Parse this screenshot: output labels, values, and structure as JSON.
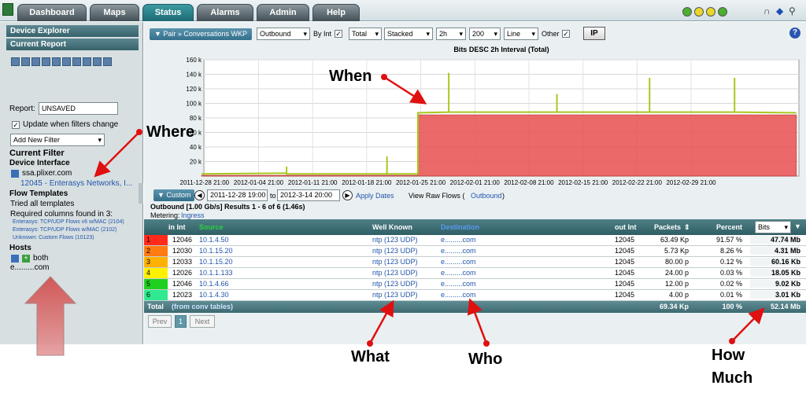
{
  "tabs": [
    {
      "label": "Dashboard",
      "active": false
    },
    {
      "label": "Maps",
      "active": false
    },
    {
      "label": "Status",
      "active": true
    },
    {
      "label": "Alarms",
      "active": false
    },
    {
      "label": "Admin",
      "active": false
    },
    {
      "label": "Help",
      "active": false
    }
  ],
  "status_colors": [
    "#4caf30",
    "#e8d62a",
    "#e8d62a",
    "#4caf30"
  ],
  "sidebar": {
    "device_explorer": "Device Explorer",
    "current_report": "Current Report",
    "report_label": "Report:",
    "report_value": "UNSAVED",
    "update_label": "Update when filters change",
    "add_filter": "Add New Filter",
    "current_filter": "Current Filter",
    "device_interface": "Device Interface",
    "device_host": "ssa.plixer.com",
    "device_iface": "12045 - Enterasys Networks, I...",
    "flow_templates": "Flow Templates",
    "tried": "Tried all templates",
    "required": "Required columns found in 3:",
    "templates": [
      "Enterasys: TCP/UDP Flows v6 w/MAC (2104)",
      "Enterasys: TCP/UDP Flows w/MAC (2102)",
      "Unknown: Custom Flows (10123)"
    ],
    "hosts": "Hosts",
    "both": "both",
    "host_value": "e.........com"
  },
  "toolbar": {
    "crumb": "▼ Pair » Conversations WKP",
    "direction": "Outbound",
    "by_int": "By Int",
    "total": "Total",
    "stacked": "Stacked",
    "interval": "2h",
    "count": "200",
    "line": "Line",
    "other": "Other",
    "ip": "IP",
    "help": "?"
  },
  "chart_data": {
    "type": "area",
    "title": "Bits DESC 2h Interval (Total)",
    "xlabel": "",
    "ylabel": "",
    "ylim": [
      0,
      160
    ],
    "y_ticks": [
      "20 k",
      "40 k",
      "60 k",
      "80 k",
      "100 k",
      "120 k",
      "140 k",
      "160 k"
    ],
    "x_ticks": [
      "2011-12-28 21:00",
      "2012-01-04 21:00",
      "2012-01-11 21:00",
      "2012-01-18 21:00",
      "2012-01-25 21:00",
      "2012-02-01 21:00",
      "2012-02-08 21:00",
      "2012-02-15 21:00",
      "2012-02-22 21:00",
      "2012-02-29 21:00"
    ],
    "x_range": [
      "2011-12-28 19:00",
      "2012-03-14 20:00"
    ],
    "grid": true,
    "series": [
      {
        "color": "#e85050",
        "points": [
          [
            "2011-12-28",
            1
          ],
          [
            "2012-01-25",
            1
          ],
          [
            "2012-01-25",
            84
          ],
          [
            "2012-03-14",
            84
          ]
        ]
      },
      {
        "color": "#a8c820",
        "points": [
          [
            "2011-12-28",
            3
          ],
          [
            "2012-01-08",
            4
          ],
          [
            "2012-01-08",
            13
          ],
          [
            "2012-01-08",
            3
          ],
          [
            "2012-01-21",
            3
          ],
          [
            "2012-01-21",
            27
          ],
          [
            "2012-01-21",
            3
          ],
          [
            "2012-01-25",
            3
          ],
          [
            "2012-01-25",
            87
          ],
          [
            "2012-01-29",
            88
          ],
          [
            "2012-01-29",
            142
          ],
          [
            "2012-01-29",
            88
          ],
          [
            "2012-02-12",
            88
          ],
          [
            "2012-02-12",
            113
          ],
          [
            "2012-02-12",
            88
          ],
          [
            "2012-02-24",
            88
          ],
          [
            "2012-02-24",
            135
          ],
          [
            "2012-02-24",
            88
          ],
          [
            "2012-03-06",
            88
          ],
          [
            "2012-03-06",
            135
          ],
          [
            "2012-03-06",
            88
          ],
          [
            "2012-03-14",
            87
          ]
        ]
      }
    ]
  },
  "daterow": {
    "custom": "▼ Custom",
    "start": "2011-12-28 19:00",
    "to": "to",
    "end": "2012-3-14 20:00",
    "apply": "Apply Dates",
    "raw": "View Raw Flows (",
    "raw_link": "Outbound",
    "raw_end": ")"
  },
  "summary": {
    "line1": "Outbound [1.00 Gb/s] Results 1 - 6 of 6 (1.46s)",
    "metering": "Metering:",
    "metering_link": "Ingress"
  },
  "table": {
    "headers": {
      "in_int": "in Int",
      "source": "Source",
      "well_known": "Well Known",
      "destination": "Destination",
      "out_int": "out Int",
      "packets": "Packets",
      "percent": "Percent",
      "unit": "Bits"
    },
    "rows": [
      {
        "rank": "1",
        "color": "#ff2a1a",
        "in_int": "12046",
        "source": "10.1.4.50",
        "wk": "ntp (123 UDP)",
        "dest": "e.........com",
        "out_int": "12045",
        "packets": "63.49 Kp",
        "percent": "91.57 %",
        "bits": "47.74 Mb"
      },
      {
        "rank": "2",
        "color": "#ff7a10",
        "in_int": "12030",
        "source": "10.1.15.20",
        "wk": "ntp (123 UDP)",
        "dest": "e.........com",
        "out_int": "12045",
        "packets": "5.73 Kp",
        "percent": "8.26 %",
        "bits": "4.31 Mb"
      },
      {
        "rank": "3",
        "color": "#ffb000",
        "in_int": "12033",
        "source": "10.1.15.20",
        "wk": "ntp (123 UDP)",
        "dest": "e.........com",
        "out_int": "12045",
        "packets": "80.00 p",
        "percent": "0.12 %",
        "bits": "60.16 Kb"
      },
      {
        "rank": "4",
        "color": "#fff000",
        "in_int": "12026",
        "source": "10.1.1.133",
        "wk": "ntp (123 UDP)",
        "dest": "e.........com",
        "out_int": "12045",
        "packets": "24.00 p",
        "percent": "0.03 %",
        "bits": "18.05 Kb"
      },
      {
        "rank": "5",
        "color": "#20d020",
        "in_int": "12046",
        "source": "10.1.4.66",
        "wk": "ntp (123 UDP)",
        "dest": "e.........com",
        "out_int": "12045",
        "packets": "12.00 p",
        "percent": "0.02 %",
        "bits": "9.02 Kb"
      },
      {
        "rank": "6",
        "color": "#30e890",
        "in_int": "12023",
        "source": "10.1.4.30",
        "wk": "ntp (123 UDP)",
        "dest": "e.........com",
        "out_int": "12045",
        "packets": "4.00 p",
        "percent": "0.01 %",
        "bits": "3.01 Kb"
      }
    ],
    "footer": {
      "total": "Total",
      "from": "(from conv tables)",
      "packets": "69.34 Kp",
      "percent": "100 %",
      "bits": "52.14 Mb"
    }
  },
  "pager": {
    "prev": "Prev",
    "page": "1",
    "next": "Next"
  },
  "annotations": {
    "when": "When",
    "where": "Where",
    "what": "What",
    "who": "Who",
    "how1": "How",
    "how2": "Much"
  }
}
